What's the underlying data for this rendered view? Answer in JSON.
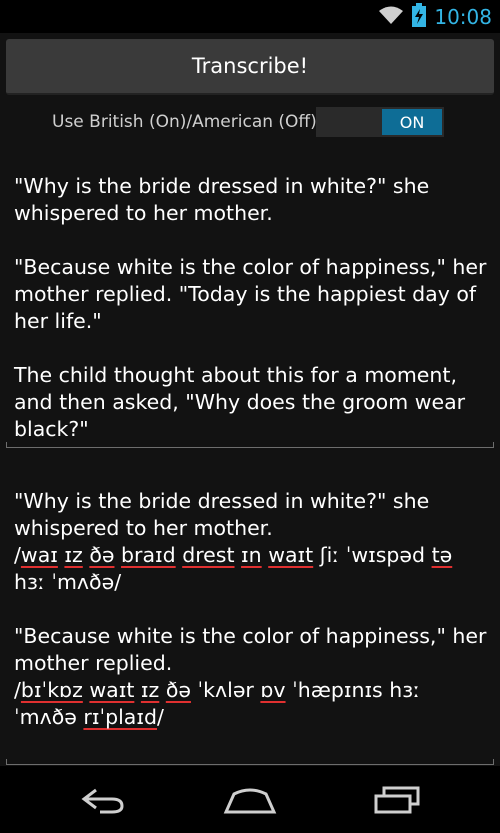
{
  "status": {
    "time": "10:08"
  },
  "toolbar": {
    "transcribe_label": "Transcribe!"
  },
  "toggle": {
    "label": "Use British (On)/American (Off)",
    "state": "ON"
  },
  "input": {
    "paragraphs": [
      "\"Why is the bride dressed in white?\" she whispered to her mother.",
      "\"Because white is the color of happiness,\" her mother replied. \"Today is the happiest day of her life.\"",
      "The child thought about this for a moment, and then asked, \"Why does the groom wear black?\""
    ]
  },
  "output": {
    "p1": "\"Why is the bride dressed in white?\" she whispered to her mother.",
    "ipa1": [
      {
        "t": "/",
        "bad": false
      },
      {
        "t": "waɪ",
        "bad": true
      },
      {
        "t": " ",
        "bad": false
      },
      {
        "t": "ɪz",
        "bad": true
      },
      {
        "t": " ",
        "bad": false
      },
      {
        "t": "ðə",
        "bad": true
      },
      {
        "t": " ",
        "bad": false
      },
      {
        "t": "braɪd",
        "bad": true
      },
      {
        "t": " ",
        "bad": false
      },
      {
        "t": "drest",
        "bad": true
      },
      {
        "t": " ",
        "bad": false
      },
      {
        "t": "ɪn",
        "bad": true
      },
      {
        "t": " ",
        "bad": false
      },
      {
        "t": "waɪt",
        "bad": true
      },
      {
        "t": " ʃiː ˈwɪspəd ",
        "bad": false
      },
      {
        "t": "tə",
        "bad": true
      },
      {
        "t": " hɜː ˈmʌðə/",
        "bad": false
      }
    ],
    "p2": "\"Because white is the color of happiness,\" her mother replied.",
    "ipa2": [
      {
        "t": "/",
        "bad": false
      },
      {
        "t": "bɪˈkɒz",
        "bad": true
      },
      {
        "t": " ",
        "bad": false
      },
      {
        "t": "waɪt",
        "bad": true
      },
      {
        "t": " ",
        "bad": false
      },
      {
        "t": "ɪz",
        "bad": true
      },
      {
        "t": " ",
        "bad": false
      },
      {
        "t": "ðə",
        "bad": true
      },
      {
        "t": " ˈkʌlər ",
        "bad": false
      },
      {
        "t": "ɒv",
        "bad": true
      },
      {
        "t": " ˈhæpɪnɪs hɜː ˈmʌðə ",
        "bad": false
      },
      {
        "t": "rɪˈplaɪd",
        "bad": true
      },
      {
        "t": "/",
        "bad": false
      }
    ]
  },
  "colors": {
    "accent": "#33b5e5",
    "switch_on": "#0e6d96",
    "misspell": "#e03030"
  }
}
